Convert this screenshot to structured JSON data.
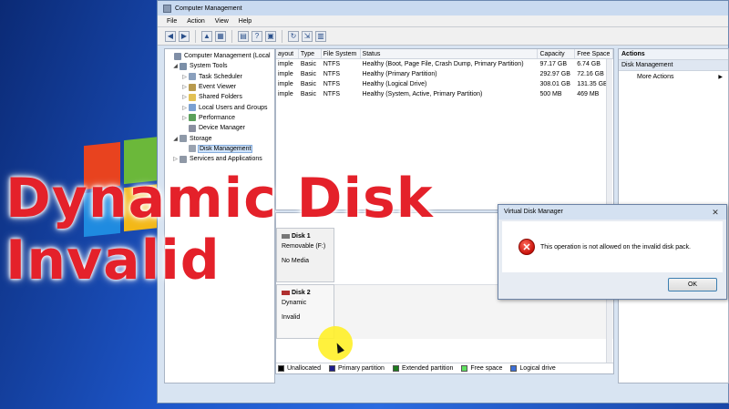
{
  "window": {
    "title": "Computer Management"
  },
  "menu": [
    "File",
    "Action",
    "View",
    "Help"
  ],
  "tree": [
    {
      "label": "Computer Management (Local",
      "level": 0,
      "expand": "",
      "color": "#7f8ea6"
    },
    {
      "label": "System Tools",
      "level": 1,
      "expand": "◢",
      "color": "#7b8fa8"
    },
    {
      "label": "Task Scheduler",
      "level": 2,
      "expand": "▷",
      "color": "#8aa0bd"
    },
    {
      "label": "Event Viewer",
      "level": 2,
      "expand": "▷",
      "color": "#b89a4e"
    },
    {
      "label": "Shared Folders",
      "level": 2,
      "expand": "▷",
      "color": "#e2c155"
    },
    {
      "label": "Local Users and Groups",
      "level": 2,
      "expand": "▷",
      "color": "#7aa0d2"
    },
    {
      "label": "Performance",
      "level": 2,
      "expand": "▷",
      "color": "#5aa05a"
    },
    {
      "label": "Device Manager",
      "level": 2,
      "expand": "",
      "color": "#8a8fa0"
    },
    {
      "label": "Storage",
      "level": 1,
      "expand": "◢",
      "color": "#8e99a8"
    },
    {
      "label": "Disk Management",
      "level": 2,
      "expand": "",
      "color": "#9aa3b0",
      "selected": true
    },
    {
      "label": "Services and Applications",
      "level": 1,
      "expand": "▷",
      "color": "#8f98a6"
    }
  ],
  "volumes": {
    "headers": [
      "ayout",
      "Type",
      "File System",
      "Status",
      "Capacity",
      "Free Space"
    ],
    "rows": [
      [
        "imple",
        "Basic",
        "NTFS",
        "Healthy (Boot, Page File, Crash Dump, Primary Partition)",
        "97.17 GB",
        "6.74 GB"
      ],
      [
        "imple",
        "Basic",
        "NTFS",
        "Healthy (Primary Partition)",
        "292.97 GB",
        "72.16 GB"
      ],
      [
        "imple",
        "Basic",
        "NTFS",
        "Healthy (Logical Drive)",
        "308.01 GB",
        "131.35 GB"
      ],
      [
        "imple",
        "Basic",
        "NTFS",
        "Healthy (System, Active, Primary Partition)",
        "500 MB",
        "469 MB"
      ]
    ]
  },
  "disks": [
    {
      "name": "Disk 1",
      "line2": "Removable (F:)",
      "line3": "No Media"
    },
    {
      "name": "Disk 2",
      "line2": "Dynamic",
      "line3": "Invalid"
    }
  ],
  "legend": [
    {
      "label": "Unallocated",
      "color": "#000000"
    },
    {
      "label": "Primary partition",
      "color": "#1c1c8c"
    },
    {
      "label": "Extended partition",
      "color": "#1d7a1d"
    },
    {
      "label": "Free space",
      "color": "#5fe05f"
    },
    {
      "label": "Logical drive",
      "color": "#3c6fd8"
    }
  ],
  "actions": {
    "header": "Actions",
    "section": "Disk Management",
    "item": "More Actions",
    "arrow": "▶"
  },
  "dialog": {
    "title": "Virtual Disk Manager",
    "message": "This operation is not allowed on the invalid disk pack.",
    "ok": "OK",
    "close": "✕"
  },
  "caption": {
    "line1": "Dynamic Disk",
    "line2": "Invalid"
  }
}
